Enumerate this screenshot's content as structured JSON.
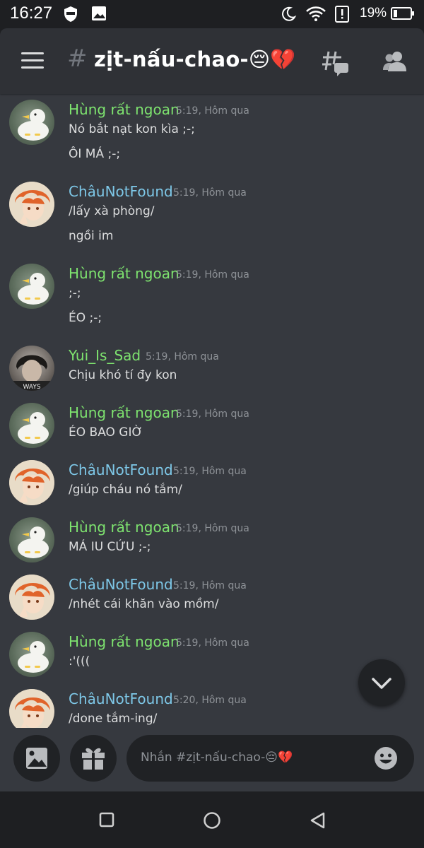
{
  "status_bar": {
    "time": "16:27",
    "battery": "19%"
  },
  "header": {
    "channel_name": "zịt-nấu-chao-😔💔"
  },
  "messages": [
    {
      "author": "Hùng rất ngoan",
      "time": "5:19, Hôm qua",
      "lines": [
        "Nó bắt nạt kon kìa ;-;",
        "ÔI MÁ ;-;"
      ],
      "avatar": "duck",
      "name_color": "#7ee36f"
    },
    {
      "author": "ChâuNotFound",
      "time": "5:19, Hôm qua",
      "lines": [
        "/lấy xà phòng/",
        "ngồi im"
      ],
      "avatar": "chau",
      "name_color": "#7ec8e8"
    },
    {
      "author": "Hùng rất ngoan",
      "time": "5:19, Hôm qua",
      "lines": [
        ";-;",
        "ÉO ;-;"
      ],
      "avatar": "duck",
      "name_color": "#7ee36f"
    },
    {
      "author": "Yui_Is_Sad",
      "time": "5:19, Hôm qua",
      "lines": [
        "Chịu khó tí đy kon"
      ],
      "avatar": "yui",
      "name_color": "#7ee36f"
    },
    {
      "author": "Hùng rất ngoan",
      "time": "5:19, Hôm qua",
      "lines": [
        "ÉO BAO GIỜ"
      ],
      "avatar": "duck",
      "name_color": "#7ee36f"
    },
    {
      "author": "ChâuNotFound",
      "time": "5:19, Hôm qua",
      "lines": [
        "/giúp cháu nó tắm/"
      ],
      "avatar": "chau",
      "name_color": "#7ec8e8"
    },
    {
      "author": "Hùng rất ngoan",
      "time": "5:19, Hôm qua",
      "lines": [
        "MÁ IU CỨU ;-;"
      ],
      "avatar": "duck",
      "name_color": "#7ee36f"
    },
    {
      "author": "ChâuNotFound",
      "time": "5:19, Hôm qua",
      "lines": [
        "/nhét cái khăn vào mồm/"
      ],
      "avatar": "chau",
      "name_color": "#7ec8e8"
    },
    {
      "author": "Hùng rất ngoan",
      "time": "5:19, Hôm qua",
      "lines": [
        ":'((("
      ],
      "avatar": "duck",
      "name_color": "#7ee36f"
    },
    {
      "author": "ChâuNotFound",
      "time": "5:20, Hôm qua",
      "lines": [
        "/done tắm-ing/"
      ],
      "avatar": "chau",
      "name_color": "#7ec8e8"
    }
  ],
  "composer": {
    "placeholder": "Nhắn #zịt-nấu-chao-😔💔"
  },
  "icons": {
    "menu": "hamburger-icon",
    "hash": "channel-hash-icon",
    "threads": "threads-icon",
    "members": "members-icon",
    "image": "image-icon",
    "gift": "gift-icon",
    "emoji": "emoji-icon",
    "scroll_down": "chevron-down-icon"
  },
  "colors": {
    "background": "#36393f",
    "header": "#2f3136",
    "green_name": "#7ee36f",
    "blue_name": "#7ec8e8"
  }
}
